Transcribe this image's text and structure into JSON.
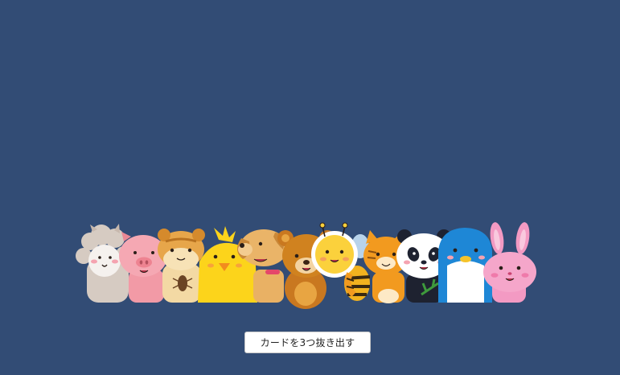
{
  "page": {
    "background": "#324c75"
  },
  "animals": [
    {
      "name": "alpaca-icon"
    },
    {
      "name": "pig-icon"
    },
    {
      "name": "hamster-icon"
    },
    {
      "name": "chick-icon"
    },
    {
      "name": "dog-icon"
    },
    {
      "name": "bear-icon"
    },
    {
      "name": "bee-icon"
    },
    {
      "name": "tiger-icon"
    },
    {
      "name": "panda-icon"
    },
    {
      "name": "penguin-icon"
    },
    {
      "name": "rabbit-icon"
    }
  ],
  "actions": {
    "draw_cards_label": "カードを3つ抜き出す"
  }
}
